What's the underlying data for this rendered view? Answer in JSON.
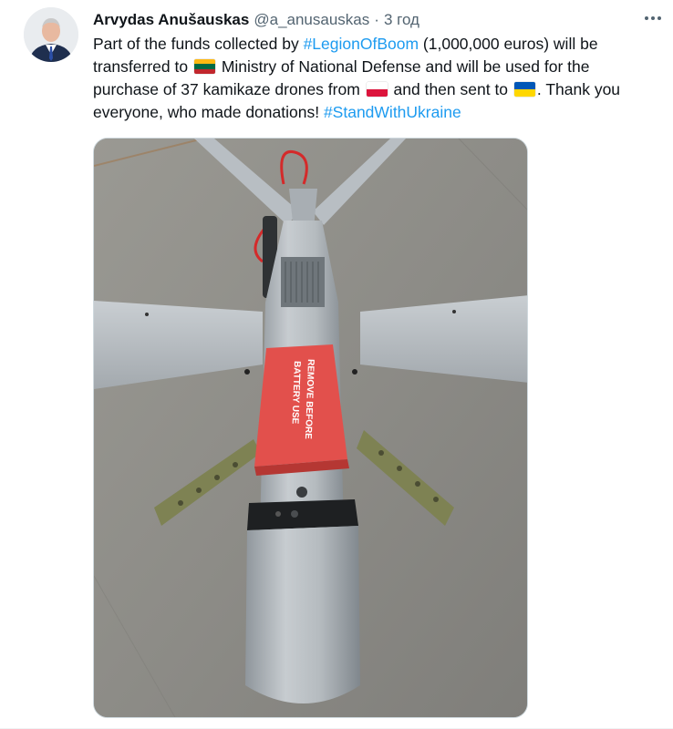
{
  "tweet": {
    "author_name": "Arvydas Anušauskas",
    "handle": "@a_anusauskas",
    "separator": "·",
    "time": "3 год",
    "text": {
      "t1": "Part of the funds collected by ",
      "hashtag1": "#LegionOfBoom",
      "t2": " (1,000,000 euros) will be transferred to ",
      "t3": " Ministry of National Defense and will be used for the purchase of 37 kamikaze drones from ",
      "t4": " and then sent to ",
      "t5": ". Thank you everyone, who made donations! ",
      "hashtag2": "#StandWithUkraine"
    },
    "flags": {
      "lithuania": [
        "#fdb913",
        "#006a44",
        "#c1272d"
      ],
      "poland": [
        "#ffffff",
        "#dc143c"
      ],
      "ukraine": [
        "#0057b7",
        "#ffd700"
      ]
    },
    "image": {
      "label_line1": "REMOVE BEFORE",
      "label_line2": "BATTERY USE"
    },
    "colors": {
      "text": "#0f1419",
      "secondary": "#536471",
      "link": "#1d9bf0"
    }
  }
}
